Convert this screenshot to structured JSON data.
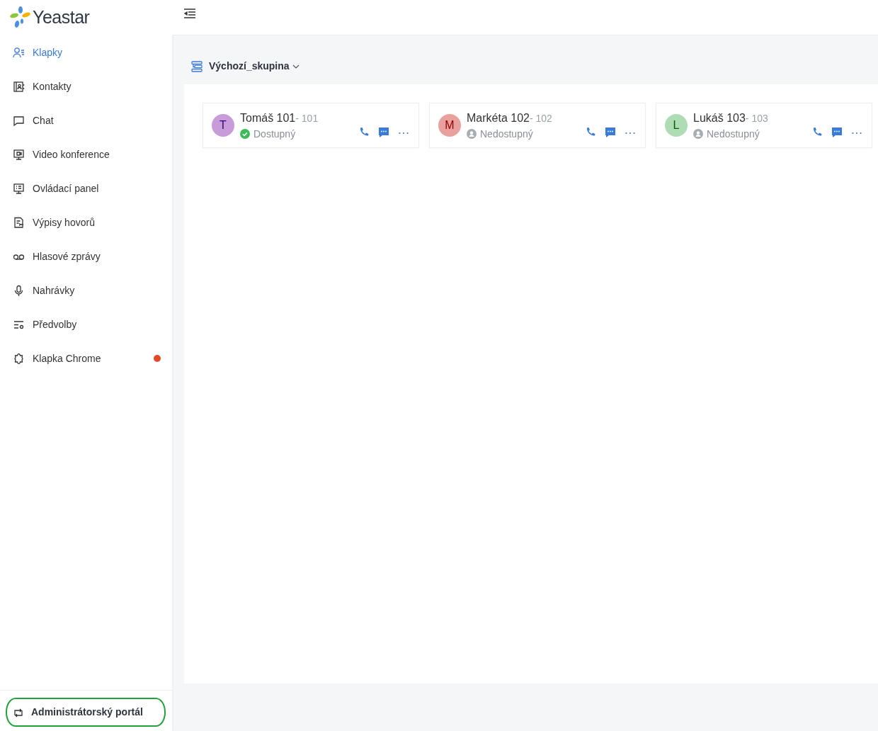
{
  "brand": {
    "name": "Yeastar"
  },
  "sidebar": {
    "items": [
      {
        "label": "Klapky",
        "selected": true,
        "badge": false
      },
      {
        "label": "Kontakty",
        "selected": false,
        "badge": false
      },
      {
        "label": "Chat",
        "selected": false,
        "badge": false
      },
      {
        "label": "Video konference",
        "selected": false,
        "badge": false
      },
      {
        "label": "Ovládací panel",
        "selected": false,
        "badge": false
      },
      {
        "label": "Výpisy hovorů",
        "selected": false,
        "badge": false
      },
      {
        "label": "Hlasové zprávy",
        "selected": false,
        "badge": false
      },
      {
        "label": "Nahrávky",
        "selected": false,
        "badge": false
      },
      {
        "label": "Předvolby",
        "selected": false,
        "badge": false
      },
      {
        "label": "Klapka Chrome",
        "selected": false,
        "badge": true
      }
    ],
    "footer": {
      "label": "Administrátorský portál",
      "highlighted": true
    }
  },
  "group": {
    "label": "Výchozí_skupina"
  },
  "extensions": [
    {
      "initial": "T",
      "color": "#c89bd9",
      "name": "Tomáš 101",
      "number": "- 101",
      "status": "Dostupný",
      "available": true
    },
    {
      "initial": "M",
      "color": "#e8a19c",
      "name": "Markéta 102",
      "number": "- 102",
      "status": "Nedostupný",
      "available": false
    },
    {
      "initial": "L",
      "color": "#aedcb4",
      "name": "Lukáš 103",
      "number": "- 103",
      "status": "Nedostupný",
      "available": false
    }
  ]
}
